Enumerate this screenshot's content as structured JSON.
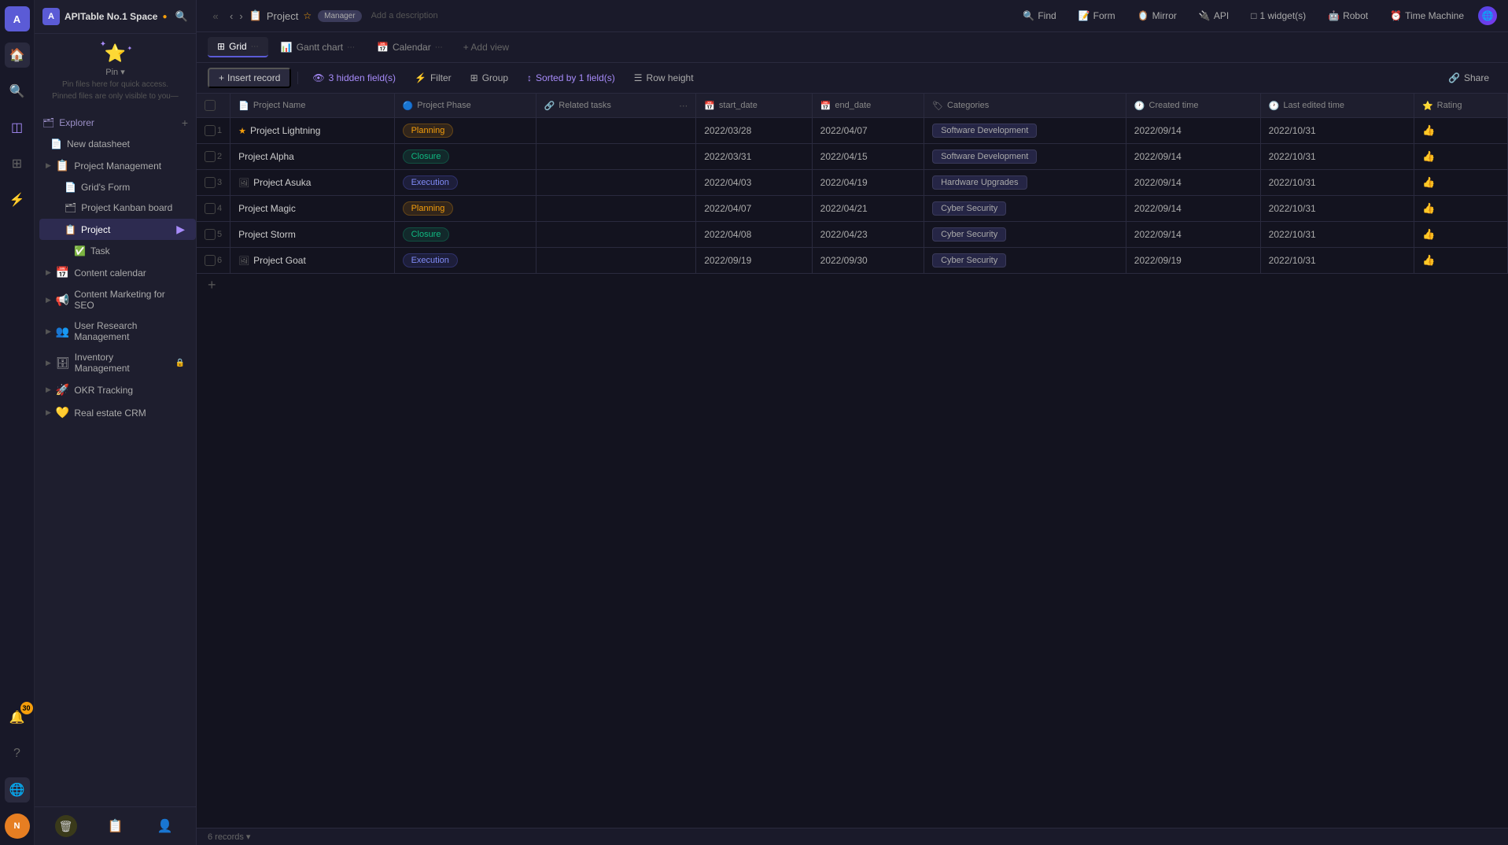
{
  "app": {
    "space_title": "APITable No.1 Space",
    "space_dot_color": "#f59e0b"
  },
  "breadcrumb": {
    "project_icon": "📋",
    "project_name": "Project",
    "star": "☆",
    "badge": "Manager",
    "add_desc": "Add a description"
  },
  "topbar_right": {
    "find": "Find",
    "form": "Form",
    "mirror": "Mirror",
    "api": "API",
    "widget": "1 widget(s)",
    "robot": "Robot",
    "time_machine": "Time Machine"
  },
  "view_tabs": [
    {
      "icon": "⊞",
      "label": "Grid",
      "active": true
    },
    {
      "icon": "📊",
      "label": "Gantt chart",
      "active": false
    },
    {
      "icon": "📅",
      "label": "Calendar",
      "active": false
    }
  ],
  "add_view_label": "+ Add view",
  "toolbar": {
    "collapse": "«",
    "nav_back": "‹",
    "nav_fwd": "›",
    "insert_record": "Insert record",
    "hidden_fields": "3 hidden field(s)",
    "filter": "Filter",
    "group": "Group",
    "sort": "Sorted by 1 field(s)",
    "row_height": "Row height",
    "share": "Share"
  },
  "table": {
    "columns": [
      {
        "icon": "📄",
        "label": "Project Name"
      },
      {
        "icon": "🔵",
        "label": "Project Phase"
      },
      {
        "icon": "🔗",
        "label": "Related tasks"
      },
      {
        "icon": "📅",
        "label": "start_date"
      },
      {
        "icon": "📅",
        "label": "end_date"
      },
      {
        "icon": "🏷",
        "label": "Categories"
      },
      {
        "icon": "🕐",
        "label": "Created time"
      },
      {
        "icon": "🕐",
        "label": "Last edited time"
      },
      {
        "icon": "⭐",
        "label": "Rating"
      }
    ],
    "rows": [
      {
        "num": "1",
        "name": "Project Lightning",
        "phase": "Planning",
        "phase_type": "planning",
        "related_tasks": "",
        "start_date": "2022/03/28",
        "end_date": "2022/04/07",
        "category": "Software Development",
        "created_time": "2022/09/14",
        "last_edited": "2022/10/31",
        "rating": "👍",
        "has_star": true,
        "has_img": false
      },
      {
        "num": "2",
        "name": "Project Alpha",
        "phase": "Closure",
        "phase_type": "closure",
        "related_tasks": "",
        "start_date": "2022/03/31",
        "end_date": "2022/04/15",
        "category": "Software Development",
        "created_time": "2022/09/14",
        "last_edited": "2022/10/31",
        "rating": "👍",
        "has_star": false,
        "has_img": false
      },
      {
        "num": "3",
        "name": "Project Asuka",
        "phase": "Execution",
        "phase_type": "execution",
        "related_tasks": "",
        "start_date": "2022/04/03",
        "end_date": "2022/04/19",
        "category": "Hardware Upgrades",
        "created_time": "2022/09/14",
        "last_edited": "2022/10/31",
        "rating": "👍",
        "has_star": false,
        "has_img": true
      },
      {
        "num": "4",
        "name": "Project Magic",
        "phase": "Planning",
        "phase_type": "planning",
        "related_tasks": "",
        "start_date": "2022/04/07",
        "end_date": "2022/04/21",
        "category": "Cyber Security",
        "created_time": "2022/09/14",
        "last_edited": "2022/10/31",
        "rating": "👍",
        "has_star": false,
        "has_img": false
      },
      {
        "num": "5",
        "name": "Project Storm",
        "phase": "Closure",
        "phase_type": "closure",
        "related_tasks": "",
        "start_date": "2022/04/08",
        "end_date": "2022/04/23",
        "category": "Cyber Security",
        "created_time": "2022/09/14",
        "last_edited": "2022/10/31",
        "rating": "👍",
        "has_star": false,
        "has_img": false
      },
      {
        "num": "6",
        "name": "Project Goat",
        "phase": "Execution",
        "phase_type": "execution",
        "related_tasks": "",
        "start_date": "2022/09/19",
        "end_date": "2022/09/30",
        "category": "Cyber Security",
        "created_time": "2022/09/19",
        "last_edited": "2022/10/31",
        "rating": "👍",
        "has_star": false,
        "has_img": true
      }
    ],
    "records_label": "6 records ▾"
  },
  "sidebar": {
    "explorer_label": "Explorer",
    "new_datasheet": "New datasheet",
    "pin_label": "Pin ▾",
    "pin_desc_line1": "Pin files here for quick access.",
    "pin_desc_line2": "Pinned files are only visible to you—",
    "items": [
      {
        "icon": "📋",
        "label": "Project Management",
        "has_children": true,
        "children": [
          {
            "icon": "📄",
            "label": "Grid's Form"
          },
          {
            "icon": "🗂",
            "label": "Project Kanban board"
          },
          {
            "icon": "📋",
            "label": "Project",
            "active": true,
            "children": [
              {
                "icon": "✅",
                "label": "Task"
              }
            ]
          }
        ]
      },
      {
        "icon": "📅",
        "label": "Content calendar",
        "has_children": true
      },
      {
        "icon": "📢",
        "label": "Content Marketing for SEO",
        "has_children": true
      },
      {
        "icon": "👥",
        "label": "User Research Management",
        "has_children": true
      },
      {
        "icon": "🗄",
        "label": "Inventory Management",
        "has_children": true,
        "lock": true
      },
      {
        "icon": "🚀",
        "label": "OKR Tracking",
        "has_children": true
      },
      {
        "icon": "💛",
        "label": "Real estate CRM",
        "has_children": true
      }
    ]
  },
  "left_icons": {
    "avatar_label": "A",
    "home_icon": "🏠",
    "search_icon": "🔍",
    "notify_icon": "🔔",
    "notify_count": "30",
    "apps_icon": "⊞",
    "help_icon": "?",
    "settings_icon": "⚙"
  },
  "bottom_bar": {
    "records": "6 records ▾"
  }
}
